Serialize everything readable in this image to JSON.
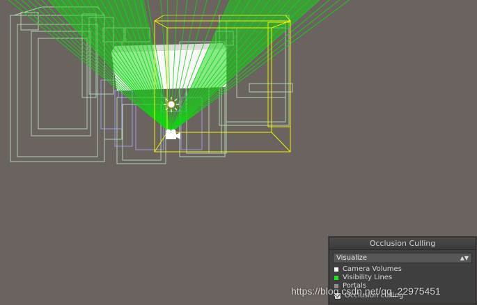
{
  "panel": {
    "title": "Occlusion Culling",
    "mode": "Visualize",
    "legend": [
      {
        "label": "Camera Volumes",
        "color": "#ffffff"
      },
      {
        "label": "Visibility Lines",
        "color": "#17e817"
      },
      {
        "label": "Portals",
        "color": "#8f8f8f"
      }
    ],
    "toggle_label": "Occlusion culling"
  },
  "scene": {
    "sun_icon": "sun-icon",
    "camera_icon": "camera-icon",
    "selection_color": "#f2f200",
    "visibility_color": "#12d612",
    "camera_volume_color": "#ffffff",
    "portal_color": "#a9a9ff",
    "wire_color": "#bfe6bf"
  },
  "watermark": "https://blog.csdn.net/qq_22975451"
}
